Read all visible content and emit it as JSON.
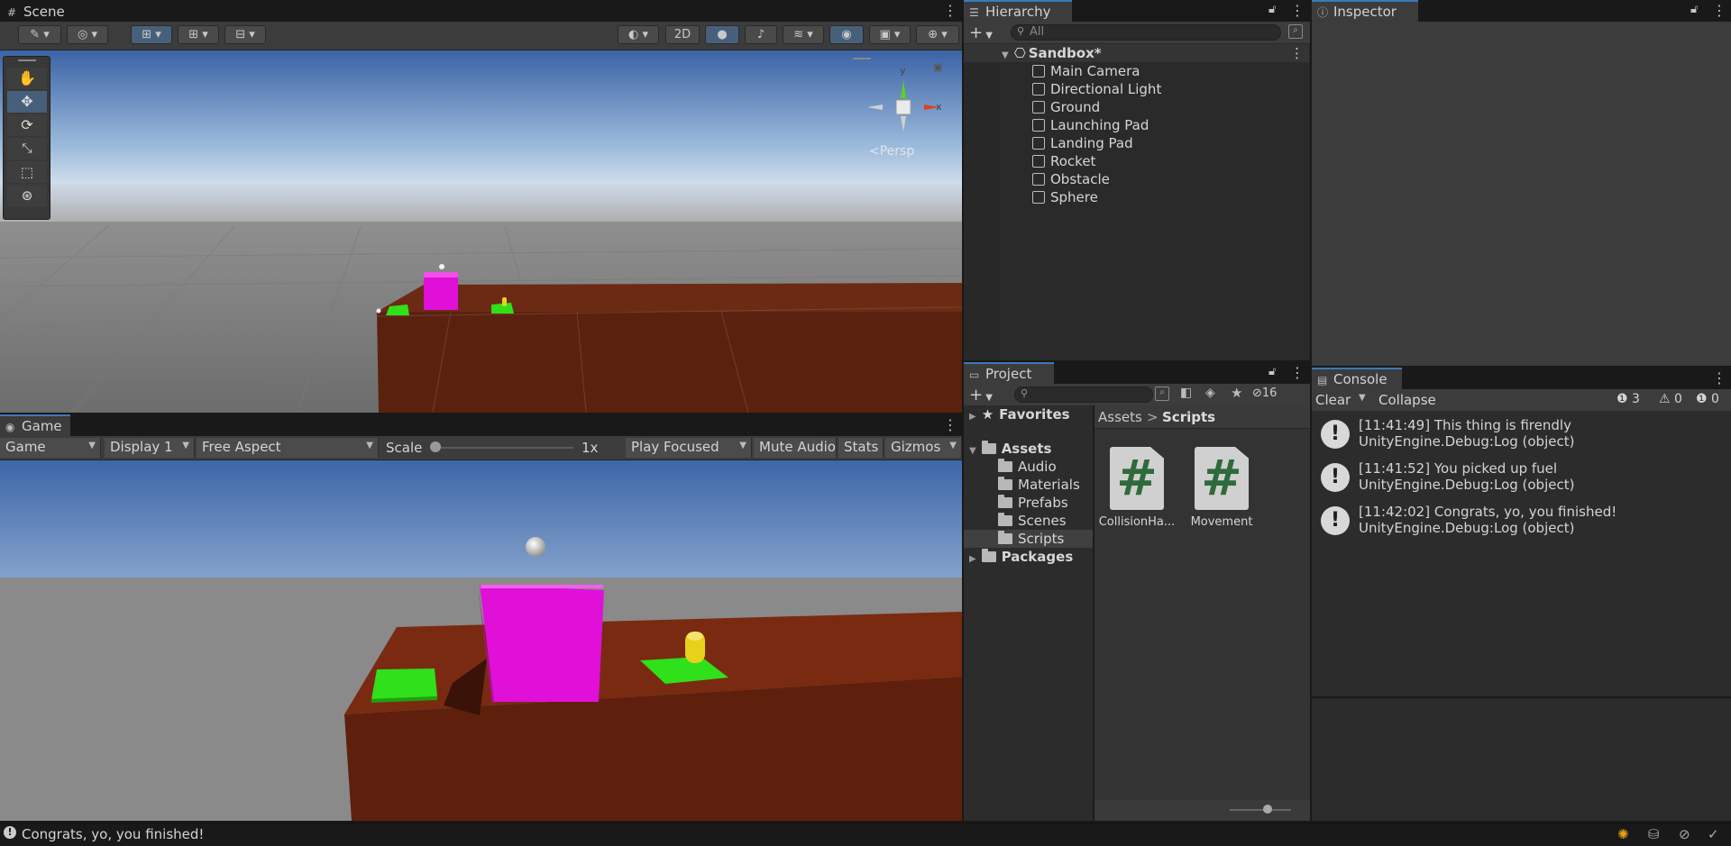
{
  "scene": {
    "tab": "Scene",
    "toolbar": {
      "mode_2d": "2D"
    },
    "tools": [
      "hand-tool",
      "move-tool",
      "rotate-tool",
      "scale-tool",
      "rect-tool",
      "transform-tool"
    ],
    "gizmo": {
      "y": "y",
      "x": "x",
      "persp": "<Persp"
    }
  },
  "game": {
    "tab": "Game",
    "view_dropdown": "Game",
    "display": "Display 1",
    "aspect": "Free Aspect",
    "scale_label": "Scale",
    "scale_value": "1x",
    "play_mode": "Play Focused",
    "mute": "Mute Audio",
    "stats": "Stats",
    "gizmos": "Gizmos"
  },
  "hierarchy": {
    "tab": "Hierarchy",
    "search_placeholder": "All",
    "scene_name": "Sandbox*",
    "items": [
      "Main Camera",
      "Directional Light",
      "Ground",
      "Launching Pad",
      "Landing Pad",
      "Rocket",
      "Obstacle",
      "Sphere"
    ]
  },
  "inspector": {
    "tab": "Inspector"
  },
  "project": {
    "tab": "Project",
    "hidden_count": "16",
    "favorites": "Favorites",
    "assets": "Assets",
    "folders": [
      "Audio",
      "Materials",
      "Prefabs",
      "Scenes",
      "Scripts"
    ],
    "packages": "Packages",
    "breadcrumb": [
      "Assets",
      "Scripts"
    ],
    "breadcrumb_sep": ">",
    "files": [
      "CollisionHa...",
      "Movement"
    ],
    "file_glyph": "#"
  },
  "console": {
    "tab": "Console",
    "clear": "Clear",
    "collapse": "Collapse",
    "counts": {
      "info": "3",
      "warn": "0",
      "error": "0"
    },
    "entries": [
      {
        "line1": "[11:41:49] This thing is firendly",
        "line2": "UnityEngine.Debug:Log (object)"
      },
      {
        "line1": "[11:41:52] You picked up fuel",
        "line2": "UnityEngine.Debug:Log (object)"
      },
      {
        "line1": "[11:42:02] Congrats, yo, you finished!",
        "line2": "UnityEngine.Debug:Log (object)"
      }
    ]
  },
  "status_bar": {
    "message": "Congrats, yo, you finished!"
  },
  "colors": {
    "magenta": "#e010d8",
    "green": "#2fe01a",
    "ground": "#6a2410",
    "yellow": "#e6d21a",
    "accent": "#3a79bb"
  }
}
